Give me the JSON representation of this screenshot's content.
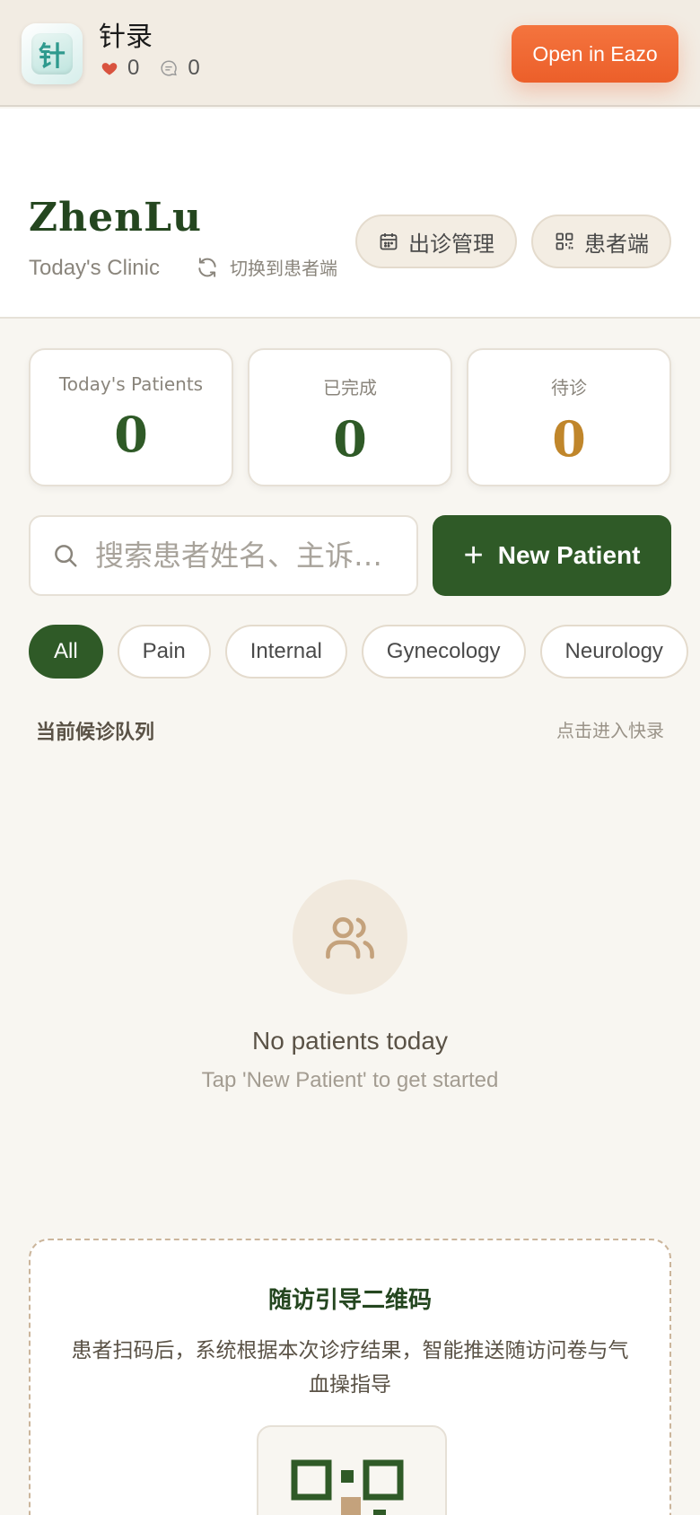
{
  "banner": {
    "app_name": "针录",
    "likes": "0",
    "comments": "0",
    "open_label": "Open in Eazo",
    "icon_glyph": "针"
  },
  "header": {
    "brand": "ZhenLu",
    "subtitle": "Today's Clinic",
    "switch_label": "切换到患者端",
    "schedule_label": "出诊管理",
    "patient_side_label": "患者端"
  },
  "stats": [
    {
      "label": "Today's Patients",
      "value": "0",
      "color": "#2f5a27"
    },
    {
      "label": "已完成",
      "value": "0",
      "color": "#2f5a27"
    },
    {
      "label": "待诊",
      "value": "0",
      "color": "#c0862b"
    }
  ],
  "search": {
    "placeholder": "搜索患者姓名、主诉…"
  },
  "new_patient": {
    "plus": "+",
    "label": "New Patient"
  },
  "filters": {
    "items": [
      "All",
      "Pain",
      "Internal",
      "Gynecology",
      "Neurology"
    ],
    "selected": "All"
  },
  "queue": {
    "title": "当前候诊队列",
    "link": "点击进入快录"
  },
  "empty_state": {
    "icon": "users-icon",
    "title": "No patients today",
    "subtitle": "Tap 'New Patient' to get started"
  },
  "qr_card": {
    "title": "随访引导二维码",
    "description": "患者扫码后，系统根据本次诊疗结果，智能推送随访问卷与气血操指导"
  },
  "colors": {
    "brand_green": "#2f5a27",
    "accent_orange": "#ec5f2a",
    "amber": "#c0862b",
    "background": "#f8f6f1"
  }
}
